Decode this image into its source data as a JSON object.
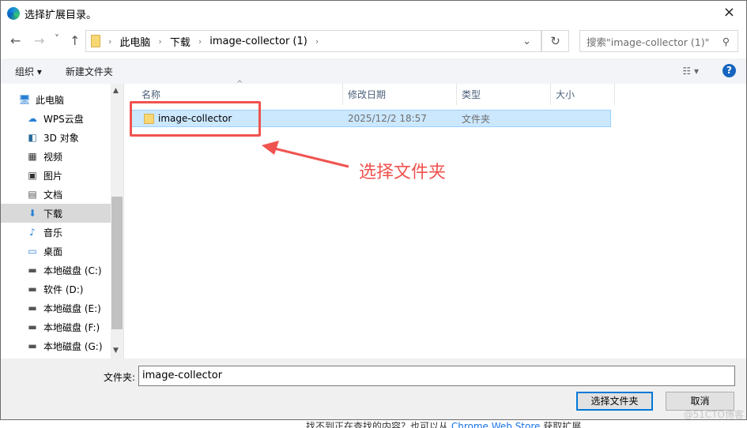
{
  "window": {
    "title": "选择扩展目录。",
    "close": "×"
  },
  "nav": {
    "back": "←",
    "forward": "→",
    "recent": "˅",
    "up": "↑",
    "breadcrumb": [
      "此电脑",
      "下载",
      "image-collector (1)"
    ],
    "refresh": "↻",
    "search_placeholder": "搜索\"image-collector (1)\"",
    "search_icon": "⚲"
  },
  "toolbar": {
    "organize": "组织 ▾",
    "new_folder": "新建文件夹",
    "view": "☷ ▾",
    "help": "?"
  },
  "sidebar": {
    "items": [
      {
        "label": "此电脑",
        "icon": "🖥"
      },
      {
        "label": "WPS云盘",
        "icon": "☁"
      },
      {
        "label": "3D 对象",
        "icon": "◧"
      },
      {
        "label": "视频",
        "icon": "▦"
      },
      {
        "label": "图片",
        "icon": "▣"
      },
      {
        "label": "文档",
        "icon": "▤"
      },
      {
        "label": "下载",
        "icon": "⬇"
      },
      {
        "label": "音乐",
        "icon": "♪"
      },
      {
        "label": "桌面",
        "icon": "▭"
      },
      {
        "label": "本地磁盘 (C:)",
        "icon": "▬"
      },
      {
        "label": "软件 (D:)",
        "icon": "▬"
      },
      {
        "label": "本地磁盘 (E:)",
        "icon": "▬"
      },
      {
        "label": "本地磁盘 (F:)",
        "icon": "▬"
      },
      {
        "label": "本地磁盘 (G:)",
        "icon": "▬"
      }
    ]
  },
  "columns": [
    "名称",
    "修改日期",
    "类型",
    "大小"
  ],
  "files": [
    {
      "name": "image-collector",
      "date": "2025/12/2 18:57",
      "type": "文件夹",
      "size": ""
    }
  ],
  "annotation": "选择文件夹",
  "footer": {
    "folder_label": "文件夹:",
    "folder_value": "image-collector",
    "select_button": "选择文件夹",
    "cancel_button": "取消"
  },
  "background": {
    "text_prefix": "找不到正在查找的内容？也可以从 ",
    "link": "Chrome Web Store",
    "text_suffix": " 获取扩展"
  },
  "watermark": "@51CTO博客"
}
